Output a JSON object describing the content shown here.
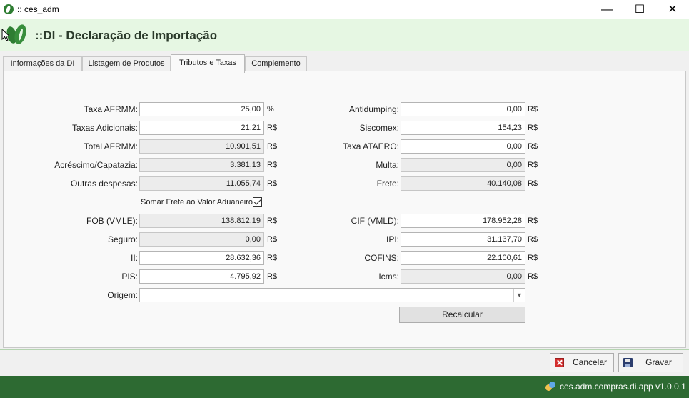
{
  "window": {
    "title": ":: ces_adm",
    "minimize": "—",
    "maximize": "☐",
    "close": "✕"
  },
  "header": {
    "title": "::DI - Declaração de Importação"
  },
  "tabs": [
    {
      "label": "Informações da DI",
      "active": false
    },
    {
      "label": "Listagem de Produtos",
      "active": false
    },
    {
      "label": "Tributos e Taxas",
      "active": true
    },
    {
      "label": "Complemento",
      "active": false
    }
  ],
  "form": {
    "left": [
      {
        "label": "Taxa AFRMM:",
        "value": "25,00",
        "unit": "%",
        "editable": true
      },
      {
        "label": "Taxas Adicionais:",
        "value": "21,21",
        "unit": "R$",
        "editable": true
      },
      {
        "label": "Total AFRMM:",
        "value": "10.901,51",
        "unit": "R$",
        "editable": false
      },
      {
        "label": "Acréscimo/Capatazia:",
        "value": "3.381,13",
        "unit": "R$",
        "editable": false
      },
      {
        "label": "Outras despesas:",
        "value": "11.055,74",
        "unit": "R$",
        "editable": false
      }
    ],
    "right": [
      {
        "label": "Antidumping:",
        "value": "0,00",
        "unit": "R$",
        "editable": true
      },
      {
        "label": "Siscomex:",
        "value": "154,23",
        "unit": "R$",
        "editable": true
      },
      {
        "label": "Taxa ATAERO:",
        "value": "0,00",
        "unit": "R$",
        "editable": true
      },
      {
        "label": "Multa:",
        "value": "0,00",
        "unit": "R$",
        "editable": false
      },
      {
        "label": "Frete:",
        "value": "40.140,08",
        "unit": "R$",
        "editable": false
      }
    ],
    "checkbox": {
      "label": "Somar Frete ao Valor Aduaneiro",
      "checked": true
    },
    "left2": [
      {
        "label": "FOB (VMLE):",
        "value": "138.812,19",
        "unit": "R$",
        "editable": false
      },
      {
        "label": "Seguro:",
        "value": "0,00",
        "unit": "R$",
        "editable": false
      },
      {
        "label": "II:",
        "value": "28.632,36",
        "unit": "R$",
        "editable": true
      },
      {
        "label": "PIS:",
        "value": "4.795,92",
        "unit": "R$",
        "editable": true
      }
    ],
    "right2": [
      {
        "label": "CIF (VMLD):",
        "value": "178.952,28",
        "unit": "R$",
        "editable": true
      },
      {
        "label": "IPI:",
        "value": "31.137,70",
        "unit": "R$",
        "editable": true
      },
      {
        "label": "COFINS:",
        "value": "22.100,61",
        "unit": "R$",
        "editable": true
      },
      {
        "label": "Icms:",
        "value": "0,00",
        "unit": "R$",
        "editable": false
      }
    ],
    "origem": {
      "label": "Origem:",
      "value": "",
      "arrow": "▼"
    },
    "recalcular": "Recalcular"
  },
  "footer": {
    "cancel": "Cancelar",
    "save": "Gravar"
  },
  "status": {
    "app_version": "ces.adm.compras.di.app v1.0.0.1"
  },
  "colors": {
    "header_bg": "#e6f7e3",
    "status_bg": "#2d6a32",
    "brand_green": "#2e7d32"
  },
  "icons": {
    "app": "leaf-icon",
    "logo": "leaf-logo-icon",
    "cancel": "cancel-x-icon",
    "save": "floppy-disk-icon",
    "status": "app-version-icon"
  }
}
